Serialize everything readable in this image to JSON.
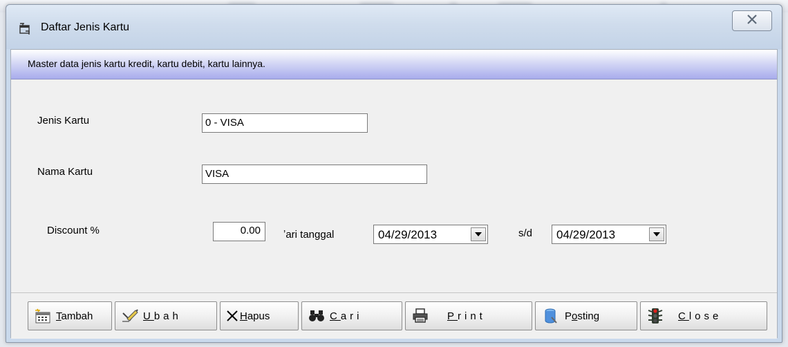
{
  "window": {
    "title": "Daftar Jenis Kartu",
    "close_symbol": "X"
  },
  "description": "Master data jenis kartu kredit, kartu debit, kartu lainnya.",
  "form": {
    "jenis_label": "Jenis Kartu",
    "jenis_value": "0 - VISA",
    "nama_label": "Nama Kartu",
    "nama_value": "VISA",
    "discount_label": "Discount %",
    "discount_value": "0.00",
    "dari_label": "ʼari tanggal",
    "dari_value": "04/29/2013",
    "sd_label": "s/d",
    "sd_value": "04/29/2013"
  },
  "toolbar": {
    "tambah": {
      "accel": "T",
      "rest": "ambah"
    },
    "ubah": {
      "accel": "U",
      "rest": "bah"
    },
    "hapus": {
      "accel": "H",
      "rest": "apus"
    },
    "cari": {
      "accel": "C",
      "rest": "ari"
    },
    "print": {
      "accel": "P",
      "rest": "rint"
    },
    "posting": {
      "pre": "P",
      "accel": "o",
      "rest": "sting"
    },
    "close": {
      "accel": "C",
      "rest": "lose"
    }
  },
  "icons": {
    "title": "window-icon",
    "tambah": "calendar-new-icon",
    "ubah": "edit-pencil-icon",
    "hapus": "x-delete-icon",
    "cari": "binoculars-icon",
    "print": "printer-icon",
    "posting": "db-cylinder-icon",
    "close": "traffic-light-icon"
  }
}
